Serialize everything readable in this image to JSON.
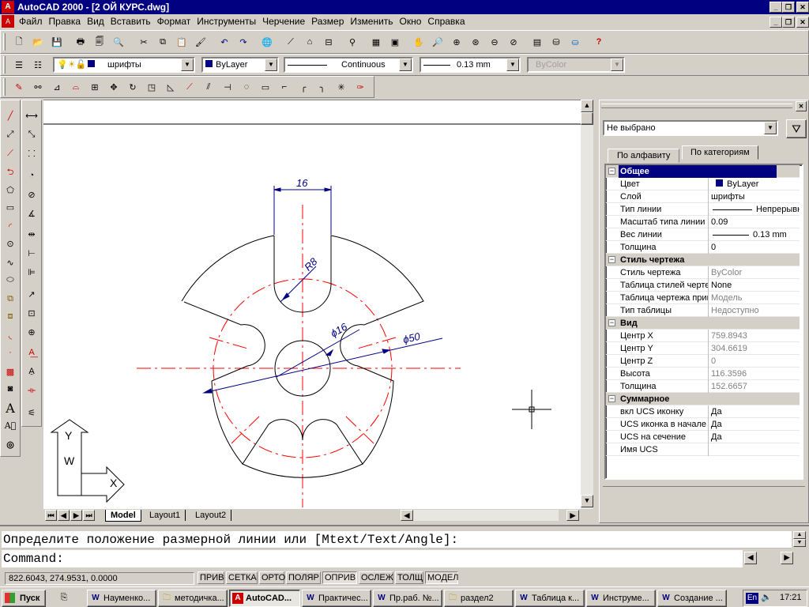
{
  "window": {
    "title": "AutoCAD 2000 - [2 ОЙ КУРС.dwg]"
  },
  "menu": [
    "Файл",
    "Правка",
    "Вид",
    "Вставить",
    "Формат",
    "Инструменты",
    "Черчение",
    "Размер",
    "Изменить",
    "Окно",
    "Справка"
  ],
  "properties_toolbar": {
    "layer": "шрифты",
    "color": "ByLayer",
    "linetype": "Continuous",
    "lineweight": "0.13 mm",
    "plotstyle": "ByColor"
  },
  "palette": {
    "selection": "Не выбрано",
    "tab_alpha": "По алфавиту",
    "tab_cat": "По категориям",
    "rows": [
      {
        "k": "Общее",
        "v": "",
        "cat": true,
        "sel": true
      },
      {
        "k": "Цвет",
        "v": "ByLayer",
        "swatch": true
      },
      {
        "k": "Слой",
        "v": "шрифты"
      },
      {
        "k": "Тип линии",
        "v": "Непрерывн",
        "line": true
      },
      {
        "k": "Масштаб типа линии",
        "v": "0.09"
      },
      {
        "k": "Вес линии",
        "v": "0.13 mm",
        "line": true
      },
      {
        "k": "Толщина",
        "v": "0"
      },
      {
        "k": "Стиль чертежа",
        "v": "",
        "cat": true
      },
      {
        "k": "Стиль чертежа",
        "v": "ByColor",
        "gray": true
      },
      {
        "k": "Таблица стилей черте",
        "v": "None"
      },
      {
        "k": "Таблица чертежа прив",
        "v": "Модель",
        "gray": true
      },
      {
        "k": "Тип таблицы",
        "v": "Недоступно",
        "gray": true
      },
      {
        "k": "Вид",
        "v": "",
        "cat": true
      },
      {
        "k": "Центр X",
        "v": "759.8943",
        "gray": true
      },
      {
        "k": "Центр Y",
        "v": "304.6619",
        "gray": true
      },
      {
        "k": "Центр Z",
        "v": "0",
        "gray": true
      },
      {
        "k": "Высота",
        "v": "116.3596",
        "gray": true
      },
      {
        "k": "Толщина",
        "v": "152.6657",
        "gray": true
      },
      {
        "k": "Суммарное",
        "v": "",
        "cat": true
      },
      {
        "k": "вкл UCS иконку",
        "v": "Да"
      },
      {
        "k": "UCS иконка в начале к",
        "v": "Да"
      },
      {
        "k": "UCS на сечение",
        "v": "Да"
      },
      {
        "k": "Имя UCS",
        "v": ""
      }
    ]
  },
  "drawing": {
    "dim_width": "16",
    "dim_radius": "R8",
    "dim_inner": "ϕ16",
    "dim_outer": "ϕ50",
    "ucs_y": "Y",
    "ucs_x": "X",
    "ucs_w": "W"
  },
  "layout_tabs": [
    "Model",
    "Layout1",
    "Layout2"
  ],
  "command": {
    "line1": "Определите положение размерной линии или [Mtext/Text/Angle]:",
    "line2": "Command:"
  },
  "status": {
    "coords": "822.6043, 274.9531, 0.0000",
    "buttons": [
      "ПРИВ",
      "СЕТКА",
      "ОРТО",
      "ПОЛЯР",
      "ОПРИВ",
      "ОСЛЕЖ",
      "ТОЛЩ",
      "МОДЕЛ"
    ]
  },
  "taskbar": {
    "start": "Пуск",
    "items": [
      "Науменко...",
      "методичка...",
      "AutoCAD...",
      "Практичес...",
      "Пр.раб. №...",
      "раздел2",
      "Таблица к...",
      "Инструме...",
      "Создание ..."
    ],
    "lang": "En",
    "time": "17:21"
  },
  "colors": {
    "titlebar": "#000080",
    "accent": "#000080",
    "red_axis": "#ff0000",
    "dim_blue": "#000080"
  }
}
